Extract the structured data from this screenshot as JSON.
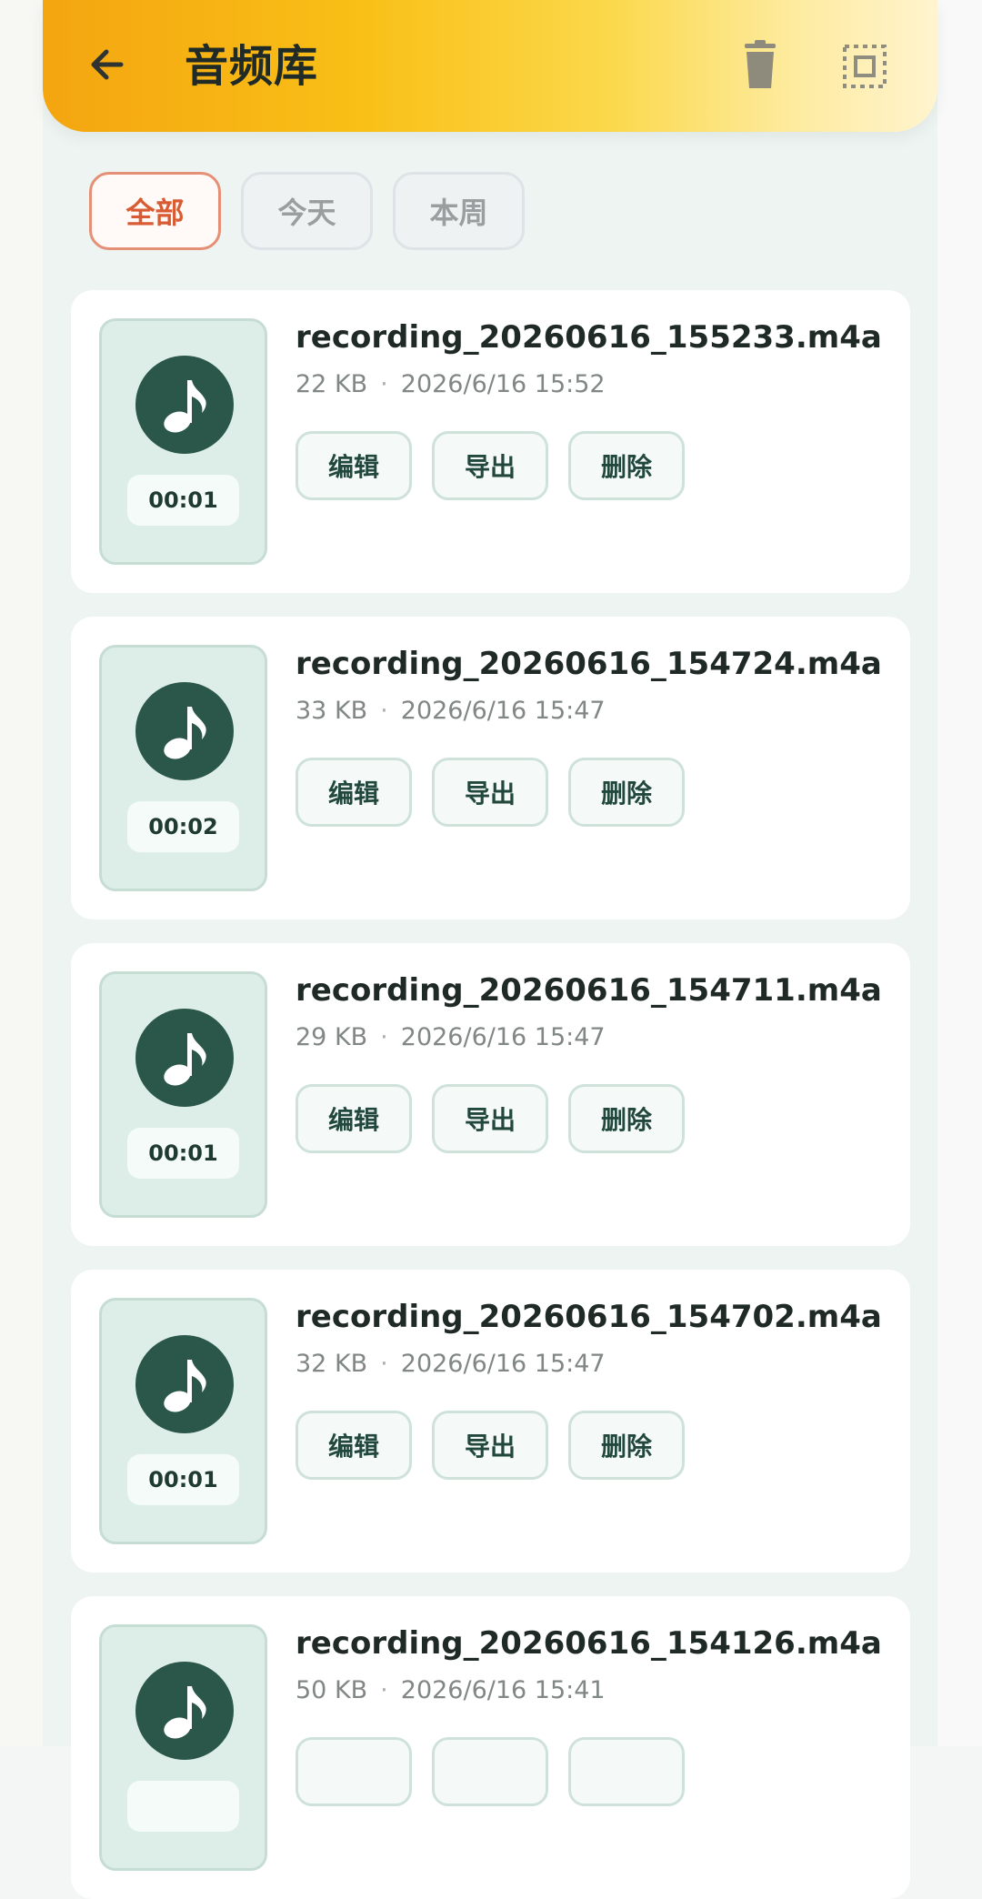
{
  "header": {
    "title": "音频库"
  },
  "icons": {
    "back": "arrow-left-icon",
    "delete": "trash-icon",
    "select": "select-all-icon",
    "audio": "music-note-icon"
  },
  "filters": [
    {
      "label": "全部",
      "selected": true
    },
    {
      "label": "今天",
      "selected": false
    },
    {
      "label": "本周",
      "selected": false
    }
  ],
  "recordings": [
    {
      "file_name": "recording_20260616_155233.m4a",
      "size": "22 KB",
      "datetime": "2026/6/16 15:52",
      "duration": "00:01",
      "actions": {
        "edit": "编辑",
        "export": "导出",
        "delete": "删除"
      }
    },
    {
      "file_name": "recording_20260616_154724.m4a",
      "size": "33 KB",
      "datetime": "2026/6/16 15:47",
      "duration": "00:02",
      "actions": {
        "edit": "编辑",
        "export": "导出",
        "delete": "删除"
      }
    },
    {
      "file_name": "recording_20260616_154711.m4a",
      "size": "29 KB",
      "datetime": "2026/6/16 15:47",
      "duration": "00:01",
      "actions": {
        "edit": "编辑",
        "export": "导出",
        "delete": "删除"
      }
    },
    {
      "file_name": "recording_20260616_154702.m4a",
      "size": "32 KB",
      "datetime": "2026/6/16 15:47",
      "duration": "00:01",
      "actions": {
        "edit": "编辑",
        "export": "导出",
        "delete": "删除"
      }
    },
    {
      "file_name": "recording_20260616_154126.m4a",
      "size": "50 KB",
      "datetime": "2026/6/16 15:41",
      "duration": "",
      "actions": {
        "edit": "",
        "export": "",
        "delete": ""
      }
    }
  ],
  "meta_separator": "·",
  "colors": {
    "header_start": "#f4a510",
    "header_end": "#fff4cf",
    "accent_selected": "#d95b33",
    "disc": "#2a5749"
  }
}
